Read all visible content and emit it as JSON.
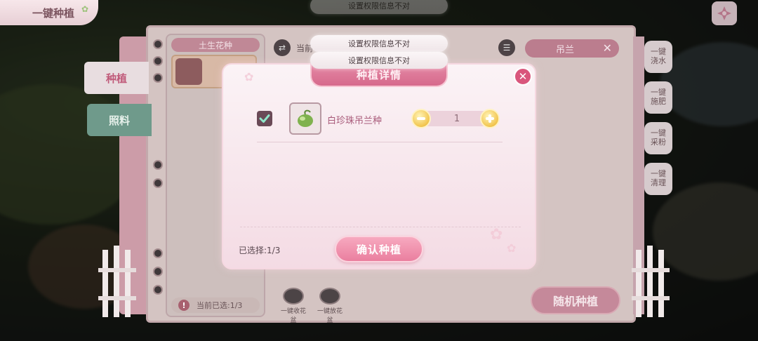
{
  "header": {
    "title": "一键种植"
  },
  "side_tabs": {
    "plant": "种植",
    "care": "照料"
  },
  "left_panel": {
    "category": "土生花种",
    "selected_status": "当前已选:1/3"
  },
  "toolbar": {
    "current_label": "当前",
    "search_value": "吊兰"
  },
  "right_actions": [
    {
      "label_line1": "一键",
      "label_line2": "浇水"
    },
    {
      "label_line1": "一键",
      "label_line2": "施肥"
    },
    {
      "label_line1": "一键",
      "label_line2": "采粉"
    },
    {
      "label_line1": "一键",
      "label_line2": "清理"
    }
  ],
  "bottom_actions": {
    "collect_pots": "一键收花盆",
    "place_pots": "一键放花盆",
    "random_plant": "随机种植"
  },
  "toasts": [
    "设置权限信息不对",
    "设置权限信息不对",
    "设置权限信息不对"
  ],
  "modal": {
    "title": "种植详情",
    "item": {
      "name": "白珍珠吊兰种",
      "checked": true,
      "quantity": "1"
    },
    "selected_count": "已选择:1/3",
    "confirm_label": "确认种植"
  },
  "colors": {
    "accent_pink": "#e58aa6",
    "confirm_pink": "#ea7f9f",
    "stepper_gold": "#f2c54f"
  }
}
